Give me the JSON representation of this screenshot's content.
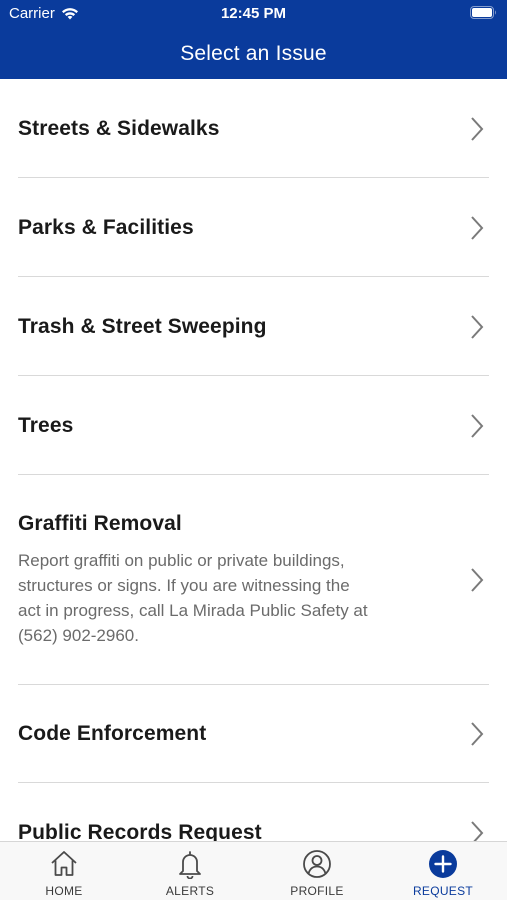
{
  "status_bar": {
    "carrier": "Carrier",
    "time": "12:45 PM"
  },
  "nav": {
    "title": "Select an Issue"
  },
  "issues": [
    {
      "label": "Streets & Sidewalks"
    },
    {
      "label": "Parks & Facilities"
    },
    {
      "label": "Trash & Street Sweeping"
    },
    {
      "label": "Trees"
    },
    {
      "label": "Graffiti Removal",
      "description": "Report graffiti on public or private buildings, structures or signs.  If you are witnessing the act in progress, call La Mirada Public Safety at (562) 902-2960."
    },
    {
      "label": "Code Enforcement"
    },
    {
      "label": "Public Records Request"
    }
  ],
  "tabs": [
    {
      "label": "HOME",
      "icon": "home-icon"
    },
    {
      "label": "ALERTS",
      "icon": "bell-icon"
    },
    {
      "label": "PROFILE",
      "icon": "profile-icon"
    },
    {
      "label": "REQUEST",
      "icon": "plus-circle-icon",
      "active": true
    }
  ],
  "colors": {
    "brand": "#0a3b9c",
    "text": "#1a1a1a",
    "muted": "#6b6b6b",
    "divider": "#d9d9d9"
  }
}
